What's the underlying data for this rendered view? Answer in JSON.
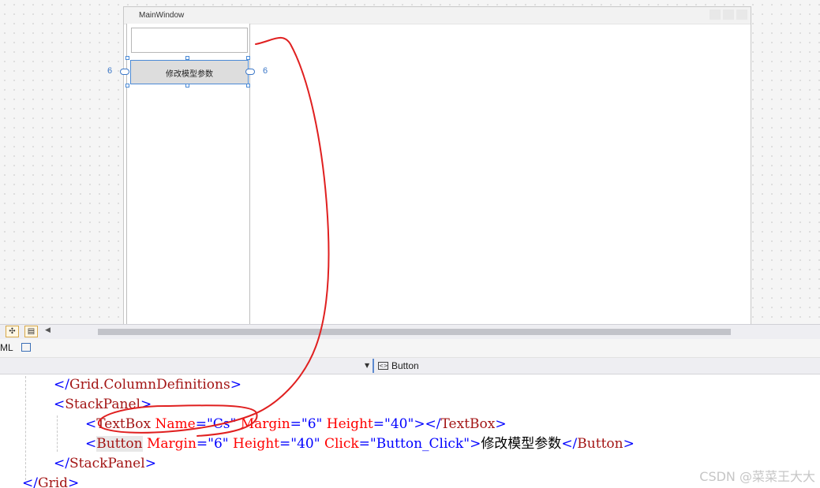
{
  "designer": {
    "window_title": "MainWindow",
    "button_label": "修改模型参数",
    "margin_left": "6",
    "margin_right": "6"
  },
  "toolbar": {
    "tab_label": "ML",
    "nav_element": "Button"
  },
  "editor": {
    "lines": [
      {
        "indent": "",
        "tokens": [
          [
            "punct",
            "</"
          ],
          [
            "tag",
            "Grid.ColumnDefinitions"
          ],
          [
            "punct",
            ">"
          ]
        ]
      },
      {
        "indent": "",
        "tokens": [
          [
            "punct",
            "<"
          ],
          [
            "tag",
            "StackPanel"
          ],
          [
            "punct",
            ">"
          ]
        ]
      },
      {
        "indent": "",
        "tokens": [
          [
            "punct",
            "<"
          ],
          [
            "tag",
            "TextBox"
          ],
          [
            "text",
            " "
          ],
          [
            "attr",
            "Name"
          ],
          [
            "punct",
            "="
          ],
          [
            "val",
            "\"Cs\""
          ],
          [
            "text",
            " "
          ],
          [
            "attr",
            "Margin"
          ],
          [
            "punct",
            "="
          ],
          [
            "val",
            "\"6\""
          ],
          [
            "text",
            " "
          ],
          [
            "attr",
            "Height"
          ],
          [
            "punct",
            "="
          ],
          [
            "val",
            "\"40\""
          ],
          [
            "punct",
            "></"
          ],
          [
            "tag",
            "TextBox"
          ],
          [
            "punct",
            ">"
          ]
        ]
      },
      {
        "indent": "",
        "tokens": [
          [
            "punct",
            "<"
          ],
          [
            "tag",
            "Button"
          ],
          [
            "text",
            " "
          ],
          [
            "attr",
            "Margin"
          ],
          [
            "punct",
            "="
          ],
          [
            "val",
            "\"6\""
          ],
          [
            "text",
            " "
          ],
          [
            "attr",
            "Height"
          ],
          [
            "punct",
            "="
          ],
          [
            "val",
            "\"40\""
          ],
          [
            "text",
            " "
          ],
          [
            "attr",
            "Click"
          ],
          [
            "punct",
            "="
          ],
          [
            "val",
            "\"Button_Click\""
          ],
          [
            "punct",
            ">"
          ],
          [
            "text",
            "修改模型参数"
          ],
          [
            "punct",
            "</"
          ],
          [
            "tag",
            "Button"
          ],
          [
            "punct",
            ">"
          ]
        ]
      },
      {
        "indent": "",
        "tokens": [
          [
            "punct",
            "</"
          ],
          [
            "tag",
            "StackPanel"
          ],
          [
            "punct",
            ">"
          ]
        ]
      },
      {
        "indent": "",
        "tokens": [
          [
            "punct",
            "</"
          ],
          [
            "tag",
            "Grid"
          ],
          [
            "punct",
            ">"
          ]
        ]
      }
    ]
  },
  "colors": {
    "tag": "#a31515",
    "attribute": "#ff0000",
    "value": "#0000ff",
    "annotation": "#e02020",
    "selection": "#4a8ad6"
  },
  "watermark": "CSDN @菜菜王大大"
}
